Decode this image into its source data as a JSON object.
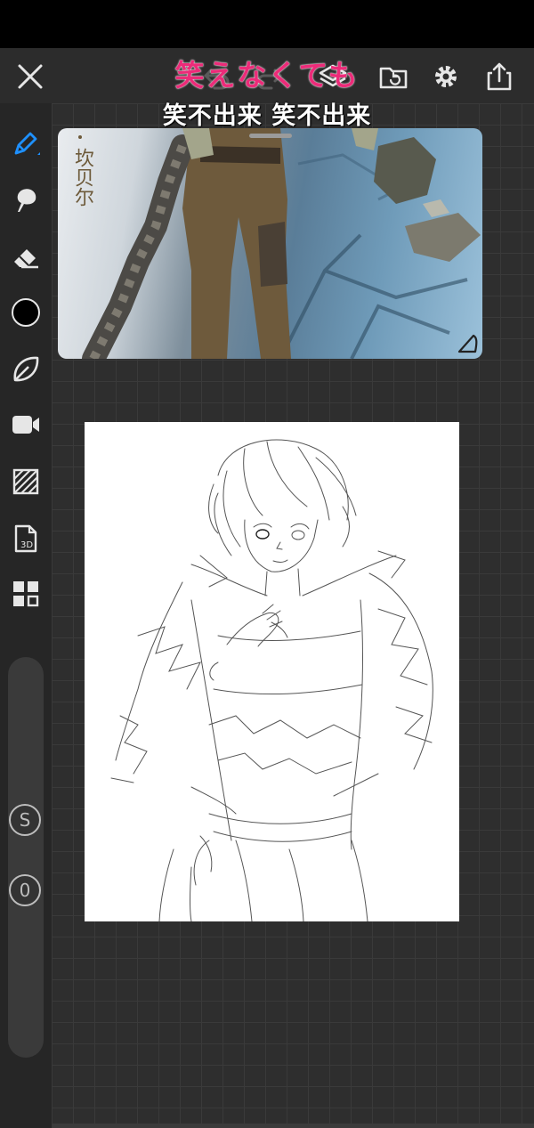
{
  "toolbar": {
    "icons": [
      "close-icon",
      "undo-icon",
      "redo-icon",
      "layers-icon",
      "folder-icon",
      "gear-icon",
      "share-icon"
    ]
  },
  "lyrics": {
    "japanese": "笑えなくても",
    "chinese": "笑不出来 笑不出来"
  },
  "reference": {
    "title": "坎贝尔"
  },
  "sidebar": {
    "tools": [
      "pen-icon",
      "smudge-icon",
      "eraser-icon",
      "color-swatch",
      "lasso-icon",
      "record-icon",
      "texture-icon",
      "3d-icon",
      "layout-icon"
    ],
    "color": "#000000",
    "size_label": "S",
    "opacity_label": "0"
  },
  "colors": {
    "accent": "#1e90ff",
    "lyric_pink": "#ec2b79"
  }
}
